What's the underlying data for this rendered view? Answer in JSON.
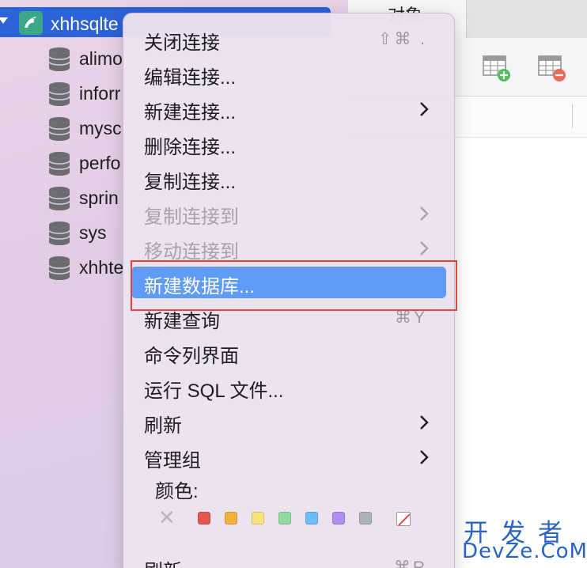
{
  "sidebar": {
    "connection": {
      "label": "xhhsqlte"
    },
    "databases": [
      {
        "label": "alimo"
      },
      {
        "label": "inforr"
      },
      {
        "label": "mysc"
      },
      {
        "label": "perfo"
      },
      {
        "label": "sprin"
      },
      {
        "label": "sys"
      },
      {
        "label": "xhhte"
      }
    ]
  },
  "right_panel": {
    "tab_objects": "对象"
  },
  "context_menu": {
    "items": [
      {
        "label": "关闭连接",
        "shortcut": "⇧⌘ .",
        "submenu": false,
        "disabled": false
      },
      {
        "label": "编辑连接...",
        "shortcut": "",
        "submenu": false,
        "disabled": false
      },
      {
        "label": "新建连接...",
        "shortcut": "",
        "submenu": true,
        "disabled": false
      },
      {
        "label": "删除连接...",
        "shortcut": "",
        "submenu": false,
        "disabled": false
      },
      {
        "label": "复制连接...",
        "shortcut": "",
        "submenu": false,
        "disabled": false
      },
      {
        "label": "复制连接到",
        "shortcut": "",
        "submenu": true,
        "disabled": true
      },
      {
        "label": "移动连接到",
        "shortcut": "",
        "submenu": true,
        "disabled": true
      },
      {
        "label": "新建数据库...",
        "shortcut": "",
        "submenu": false,
        "disabled": false,
        "selected": true
      },
      {
        "label": "新建查询",
        "shortcut": "⌘Y",
        "submenu": false,
        "disabled": false
      },
      {
        "label": "命令列界面",
        "shortcut": "",
        "submenu": false,
        "disabled": false
      },
      {
        "label": "运行 SQL 文件...",
        "shortcut": "",
        "submenu": false,
        "disabled": false
      },
      {
        "label": "刷新",
        "shortcut": "",
        "submenu": true,
        "disabled": false
      },
      {
        "label": "管理组",
        "shortcut": "",
        "submenu": true,
        "disabled": false
      },
      {
        "label": "刷新",
        "shortcut": "⌘R",
        "submenu": false,
        "disabled": false
      }
    ],
    "color_section": {
      "title": "颜色:",
      "none_symbol": "✕",
      "swatches": [
        "#e8574d",
        "#f1b23b",
        "#f8e37a",
        "#8fdc9e",
        "#6cbcf5",
        "#b18cf2",
        "#aab3bb"
      ]
    }
  },
  "watermark": {
    "line1": "开发者",
    "line2": "DevZe.CoM"
  }
}
